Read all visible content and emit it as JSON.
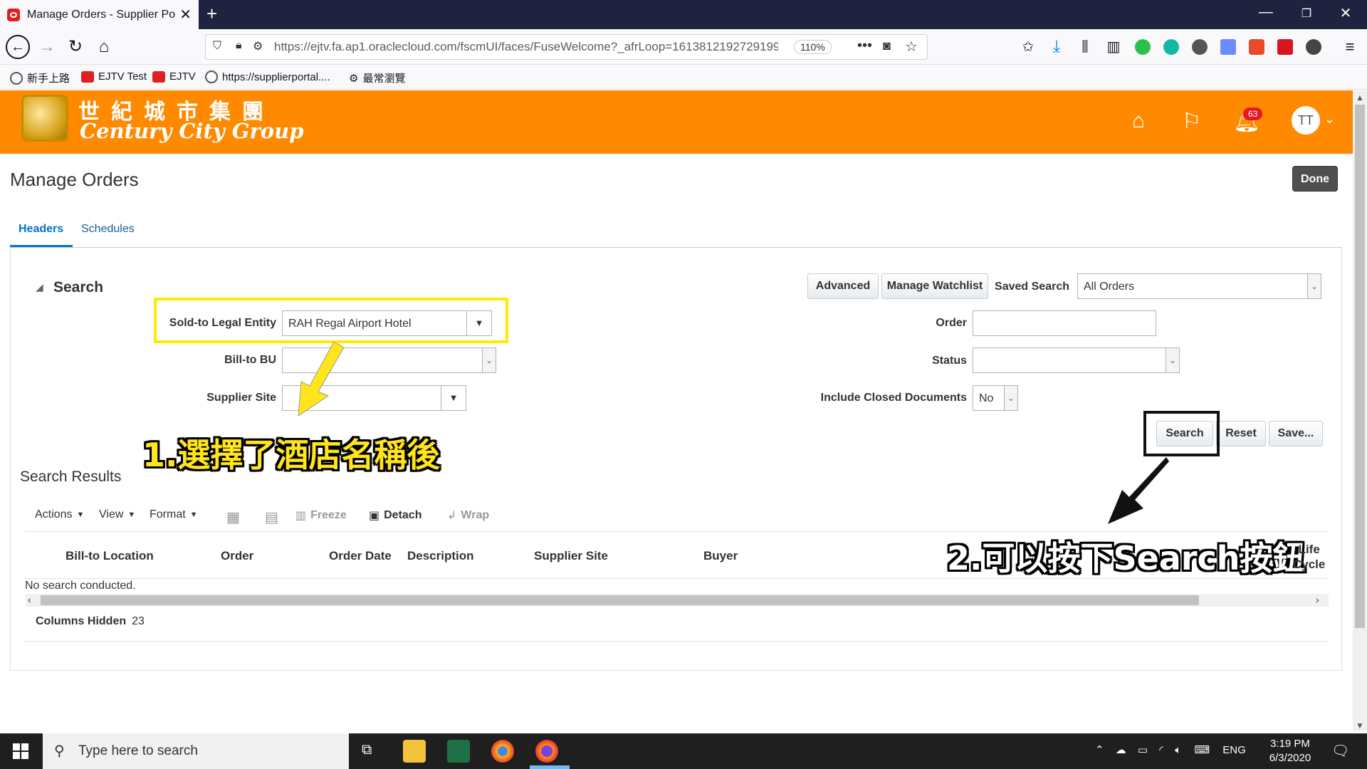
{
  "browser": {
    "tab_title": "Manage Orders - Supplier Portal",
    "url_display": "https://ejtv.fa.ap1.oraclecloud.com/fscmUI/faces/FuseWelcome?_afrLoop=1613812192729199",
    "url_host": "oraclecloud.com",
    "zoom": "110%",
    "bookmarks": [
      "新手上路",
      "EJTV Test",
      "EJTV",
      "https://supplierportal....",
      "最常瀏覽"
    ]
  },
  "header": {
    "brand_cn": "世紀城市集團",
    "brand_en": "Century City Group",
    "notification_count": "63",
    "avatar_initials": "TT"
  },
  "page": {
    "title": "Manage Orders",
    "done_label": "Done",
    "tabs": [
      "Headers",
      "Schedules"
    ]
  },
  "search": {
    "heading": "Search",
    "advanced_label": "Advanced",
    "watchlist_label": "Manage Watchlist",
    "saved_search_label": "Saved Search",
    "saved_search_value": "All Orders",
    "sold_to_label": "Sold-to Legal Entity",
    "sold_to_value": "RAH Regal Airport Hotel",
    "bill_to_bu_label": "Bill-to BU",
    "supplier_site_label": "Supplier Site",
    "order_label": "Order",
    "status_label": "Status",
    "include_closed_label": "Include Closed Documents",
    "include_closed_value": "No",
    "search_btn": "Search",
    "reset_btn": "Reset",
    "save_btn": "Save..."
  },
  "annotations": {
    "step1": "1.選擇了酒店名稱後",
    "step2": "2.可以按下Search按鈕"
  },
  "results": {
    "heading": "Search Results",
    "toolbar": {
      "actions": "Actions",
      "view": "View",
      "format": "Format",
      "freeze": "Freeze",
      "detach": "Detach",
      "wrap": "Wrap"
    },
    "columns": [
      "Bill-to Location",
      "Order",
      "Order Date",
      "Description",
      "Supplier Site",
      "Buyer"
    ],
    "life_cycle_1": "Life",
    "life_cycle_2": "Cycle",
    "empty_text": "No search conducted.",
    "columns_hidden_label": "Columns Hidden",
    "columns_hidden_count": "23"
  },
  "taskbar": {
    "search_placeholder": "Type here to search",
    "lang": "ENG",
    "time": "3:19 PM",
    "date": "6/3/2020"
  }
}
